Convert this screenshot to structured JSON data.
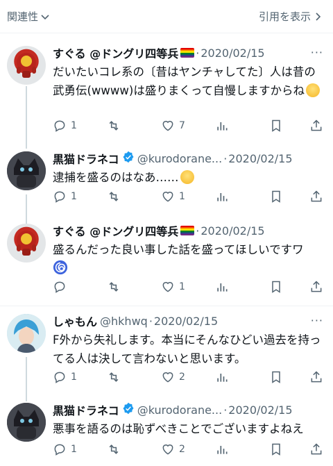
{
  "header": {
    "sort_label": "関連性",
    "quotes_label": "引用を表示"
  },
  "tweets": [
    {
      "name": "すぐる @ドングリ四等兵",
      "handle": "",
      "date": "2020/02/15",
      "text": "だいたいコレ系の〔昔はヤンチャしてた〕人は昔の武勇伝(wwww)は盛りまくって自慢しますからね",
      "emoji": "grinning-face",
      "replies": "1",
      "retweets": "",
      "likes": "7"
    },
    {
      "name": "黒猫ドラネコ",
      "handle": "@kurodorane...",
      "date": "2020/02/15",
      "text": "逮捕を盛るのはなあ……",
      "emoji": "dizzy-face",
      "replies": "1",
      "retweets": "",
      "likes": "1"
    },
    {
      "name": "すぐる @ドングリ四等兵",
      "handle": "",
      "date": "2020/02/15",
      "text": "盛るんだった良い事した話を盛ってほしいですワ",
      "emoji": "cyclone",
      "replies": "",
      "retweets": "",
      "likes": "1"
    },
    {
      "name": "しゃもん",
      "handle": "@hkhwq",
      "date": "2020/02/15",
      "text": "F外から失礼します。本当にそんなひどい過去を持ってる人は決して言わないと思います。",
      "emoji": "",
      "replies": "1",
      "retweets": "",
      "likes": "2"
    },
    {
      "name": "黒猫ドラネコ",
      "handle": "@kurodorane...",
      "date": "2020/02/15",
      "text": "悪事を語るのは恥ずべきことでございますよねえ",
      "emoji": "",
      "replies": "1",
      "retweets": "",
      "likes": "2"
    }
  ],
  "colors": {
    "text": "#0f1419",
    "muted": "#536471",
    "verified": "#1d9bf0",
    "divider": "#eff3f4"
  }
}
